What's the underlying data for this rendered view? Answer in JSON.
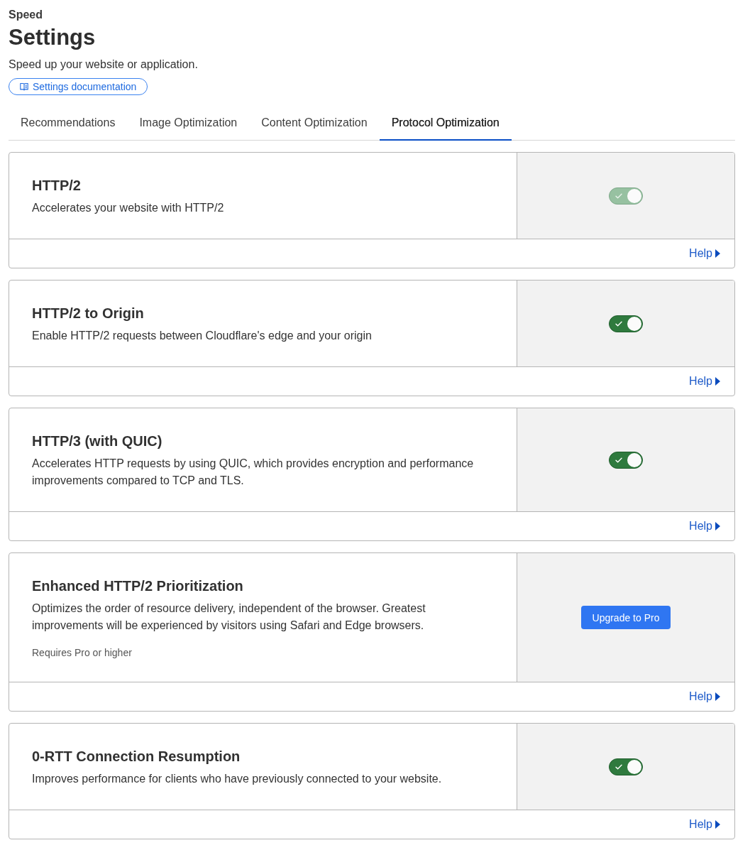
{
  "header": {
    "section": "Speed",
    "title": "Settings",
    "subtitle": "Speed up your website or application.",
    "doc_link": "Settings documentation"
  },
  "tabs": [
    {
      "label": "Recommendations",
      "selected": false
    },
    {
      "label": "Image Optimization",
      "selected": false
    },
    {
      "label": "Content Optimization",
      "selected": false
    },
    {
      "label": "Protocol Optimization",
      "selected": true
    }
  ],
  "cards": [
    {
      "title": "HTTP/2",
      "description": "Accelerates your website with HTTP/2",
      "control": {
        "kind": "toggle",
        "on": true,
        "disabled": true
      },
      "help": "Help"
    },
    {
      "title": "HTTP/2 to Origin",
      "description": "Enable HTTP/2 requests between Cloudflare's edge and your origin",
      "control": {
        "kind": "toggle",
        "on": true,
        "disabled": false
      },
      "help": "Help"
    },
    {
      "title": "HTTP/3 (with QUIC)",
      "description": "Accelerates HTTP requests by using QUIC, which provides encryption and performance improvements compared to TCP and TLS.",
      "control": {
        "kind": "toggle",
        "on": true,
        "disabled": false
      },
      "help": "Help"
    },
    {
      "title": "Enhanced HTTP/2 Prioritization",
      "description": "Optimizes the order of resource delivery, independent of the browser. Greatest improvements will be experienced by visitors using Safari and Edge browsers.",
      "note": "Requires Pro or higher",
      "control": {
        "kind": "button",
        "label": "Upgrade to Pro"
      },
      "help": "Help"
    },
    {
      "title": "0-RTT Connection Resumption",
      "description": "Improves performance for clients who have previously connected to your website.",
      "control": {
        "kind": "toggle",
        "on": true,
        "disabled": false
      },
      "help": "Help"
    }
  ]
}
